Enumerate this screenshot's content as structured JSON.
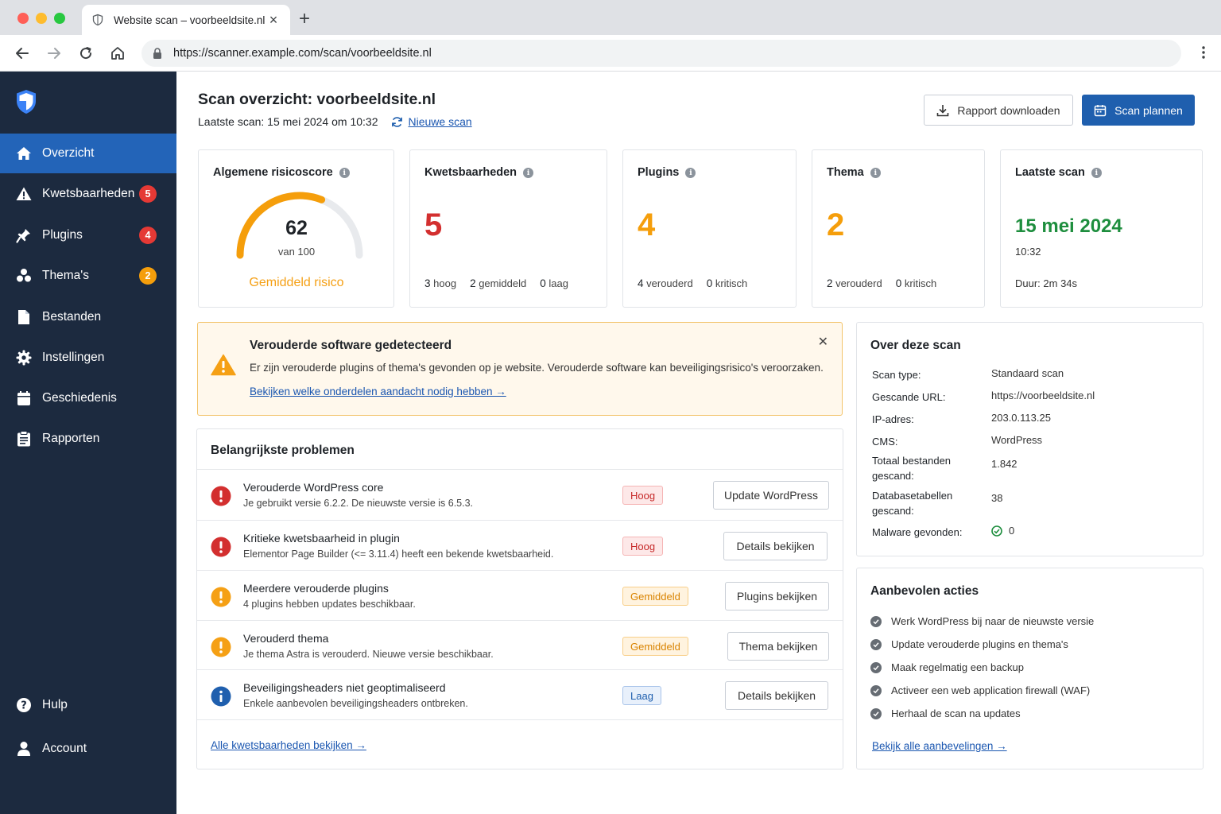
{
  "browser": {
    "tab_title": "Website scan – voorbeeldsite.nl",
    "url_scheme": "https://",
    "url_host": "scanner.example.com",
    "url_path": "/scan/voorbeeldsite.nl",
    "traffic_colors": [
      "#ff5f57",
      "#febc2e",
      "#28c840"
    ]
  },
  "sidebar": {
    "items": [
      {
        "label": "Overzicht",
        "icon": "home-icon",
        "active": true
      },
      {
        "label": "Kwetsbaarheden",
        "icon": "warning-icon",
        "badge": "5",
        "badge_color": "red"
      },
      {
        "label": "Plugins",
        "icon": "plug-icon",
        "badge": "4",
        "badge_color": "red"
      },
      {
        "label": "Thema's",
        "icon": "theme-icon",
        "badge": "2",
        "badge_color": "orange"
      },
      {
        "label": "Bestanden",
        "icon": "file-icon"
      },
      {
        "label": "Instellingen",
        "icon": "gear-icon"
      },
      {
        "label": "Geschiedenis",
        "icon": "history-icon"
      },
      {
        "label": "Rapporten",
        "icon": "report-icon"
      }
    ],
    "bottom": [
      {
        "label": "Hulp",
        "icon": "help-icon"
      },
      {
        "label": "Account",
        "icon": "user-icon"
      }
    ]
  },
  "header": {
    "title": "Scan overzicht: voorbeeldsite.nl",
    "last_scan": "Laatste scan: 15 mei 2024 om 10:32",
    "new_scan": "Nieuwe scan",
    "download_label": "Rapport downloaden",
    "plan_label": "Scan plannen"
  },
  "cards": {
    "risk": {
      "title": "Algemene risicoscore",
      "score": "62",
      "of": "van 100",
      "label": "Gemiddeld risico",
      "score_fraction": 0.62,
      "color": "#f59e0b"
    },
    "vuln": {
      "title": "Kwetsbaarheden",
      "value": "5",
      "s1n": "3",
      "s1": "hoog",
      "s2n": "2",
      "s2": "gemiddeld",
      "s3n": "0",
      "s3": "laag",
      "color": "#d32f2f"
    },
    "plugins": {
      "title": "Plugins",
      "value": "4",
      "s1n": "4",
      "s1": "verouderd",
      "s2n": "0",
      "s2": "kritisch",
      "color": "#f59e0b"
    },
    "theme": {
      "title": "Thema",
      "value": "2",
      "s1n": "2",
      "s1": "verouderd",
      "s2n": "0",
      "s2": "kritisch",
      "color": "#f59e0b"
    },
    "last": {
      "title": "Laatste scan",
      "date": "15 mei 2024",
      "time": "10:32",
      "duration": "Duur: 2m 34s",
      "color": "#1e8e3e"
    }
  },
  "alert": {
    "title": "Verouderde software gedetecteerd",
    "text": "Er zijn verouderde plugins of thema's gevonden op je website. Verouderde software kan beveiligingsrisico's veroorzaken.",
    "link": "Bekijken welke onderdelen aandacht nodig hebben →"
  },
  "problems": {
    "title": "Belangrijkste problemen",
    "rows": [
      {
        "title": "Verouderde WordPress core",
        "desc": "Je gebruikt versie 6.2.2. De nieuwste versie is 6.5.3.",
        "severity": "Hoog",
        "level": "hoog",
        "icon": "error-icon",
        "button": "Update WordPress"
      },
      {
        "title": "Kritieke kwetsbaarheid in plugin",
        "desc": "Elementor Page Builder (<= 3.11.4) heeft een bekende kwetsbaarheid.",
        "severity": "Hoog",
        "level": "hoog",
        "icon": "error-icon",
        "button": "Details bekijken"
      },
      {
        "title": "Meerdere verouderde plugins",
        "desc": "4 plugins hebben updates beschikbaar.",
        "severity": "Gemiddeld",
        "level": "gem",
        "icon": "warning-circle-icon",
        "button": "Plugins bekijken"
      },
      {
        "title": "Verouderd thema",
        "desc": "Je thema Astra is verouderd. Nieuwe versie beschikbaar.",
        "severity": "Gemiddeld",
        "level": "gem",
        "icon": "warning-circle-icon",
        "button": "Thema bekijken"
      },
      {
        "title": "Beveiligingsheaders niet geoptimaliseerd",
        "desc": "Enkele aanbevolen beveiligingsheaders ontbreken.",
        "severity": "Laag",
        "level": "laag",
        "icon": "info-icon",
        "button": "Details bekijken"
      }
    ],
    "footer": "Alle kwetsbaarheden bekijken →"
  },
  "about": {
    "title": "Over deze scan",
    "rows": [
      {
        "k": "Scan type:",
        "v": "Standaard scan"
      },
      {
        "k": "Gescande URL:",
        "v": "https://voorbeeldsite.nl"
      },
      {
        "k": "IP-adres:",
        "v": "203.0.113.25"
      },
      {
        "k": "CMS:",
        "v": "WordPress"
      },
      {
        "k": "Totaal bestanden gescand:",
        "v": "1.842"
      },
      {
        "k": "Databasetabellen gescand:",
        "v": "38"
      },
      {
        "k": "Malware gevonden:",
        "v": "0"
      }
    ]
  },
  "recommended": {
    "title": "Aanbevolen acties",
    "items": [
      "Werk WordPress bij naar de nieuwste versie",
      "Update verouderde plugins en thema's",
      "Maak regelmatig een backup",
      "Activeer een web application firewall (WAF)",
      "Herhaal de scan na updates"
    ],
    "link": "Bekijk alle aanbevelingen →"
  }
}
